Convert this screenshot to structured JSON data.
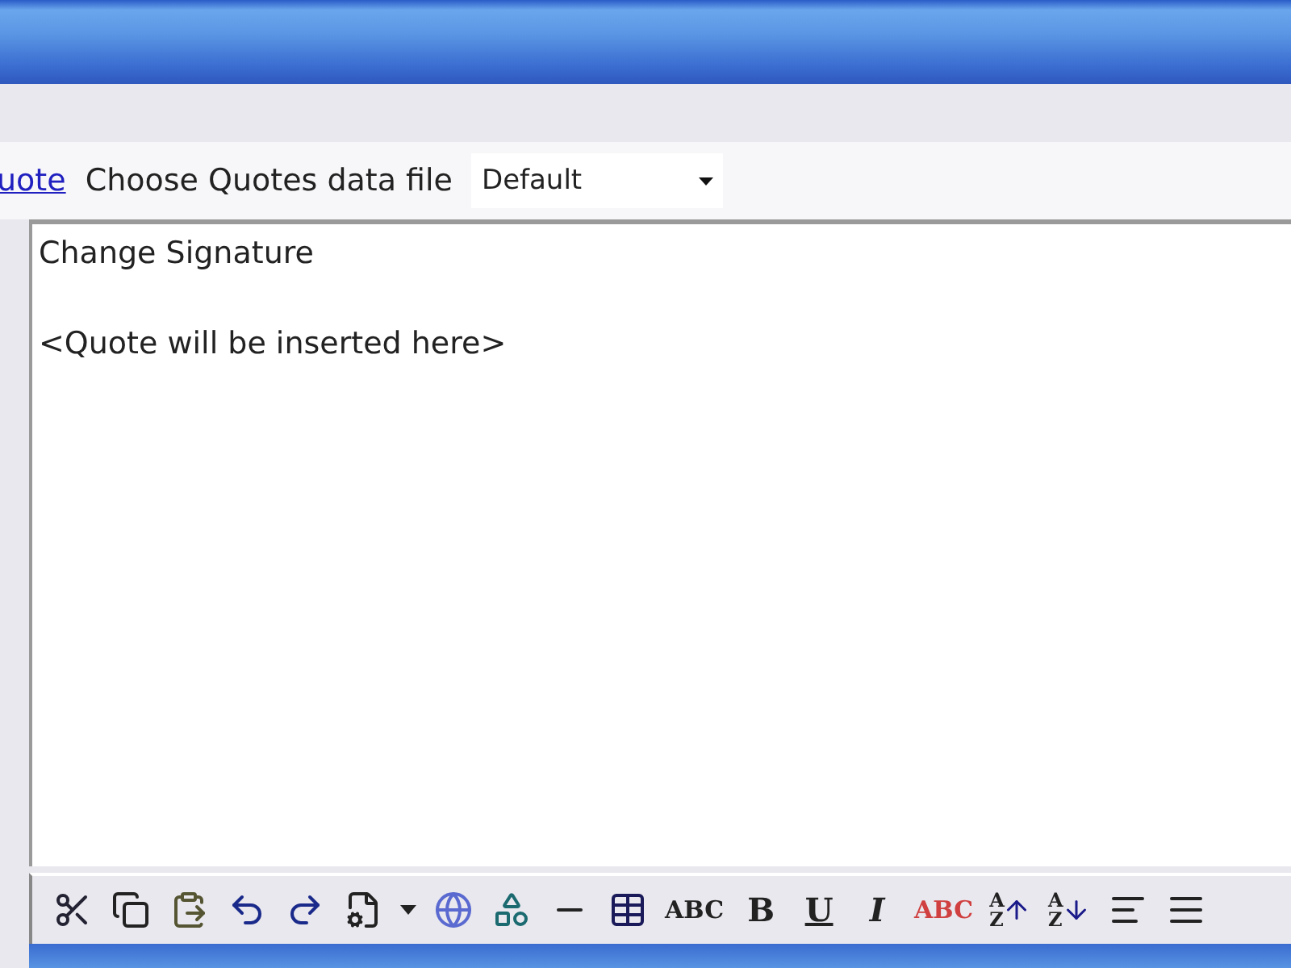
{
  "quote_bar": {
    "link": "uote",
    "label": "Choose Quotes data file",
    "select": {
      "value": "Default"
    }
  },
  "editor": {
    "heading": "Change Signature",
    "body": "<Quote will be inserted here>"
  },
  "toolbar": [
    {
      "kind": "cut"
    },
    {
      "kind": "copy"
    },
    {
      "kind": "paste"
    },
    {
      "kind": "undo"
    },
    {
      "kind": "redo"
    },
    {
      "kind": "properties"
    },
    {
      "kind": "caret"
    },
    {
      "kind": "globe"
    },
    {
      "kind": "shapes"
    },
    {
      "kind": "line"
    },
    {
      "kind": "table"
    },
    {
      "kind": "caps",
      "glyph": "ABC"
    },
    {
      "kind": "bold",
      "glyph": "B"
    },
    {
      "kind": "underline",
      "glyph": "U"
    },
    {
      "kind": "italic",
      "glyph": "I"
    },
    {
      "kind": "spell",
      "glyph": "ABC"
    },
    {
      "kind": "sort-up",
      "glyph": "AZ"
    },
    {
      "kind": "sort-down",
      "glyph": "AZ"
    },
    {
      "kind": "align-left"
    },
    {
      "kind": "align-justify"
    }
  ]
}
